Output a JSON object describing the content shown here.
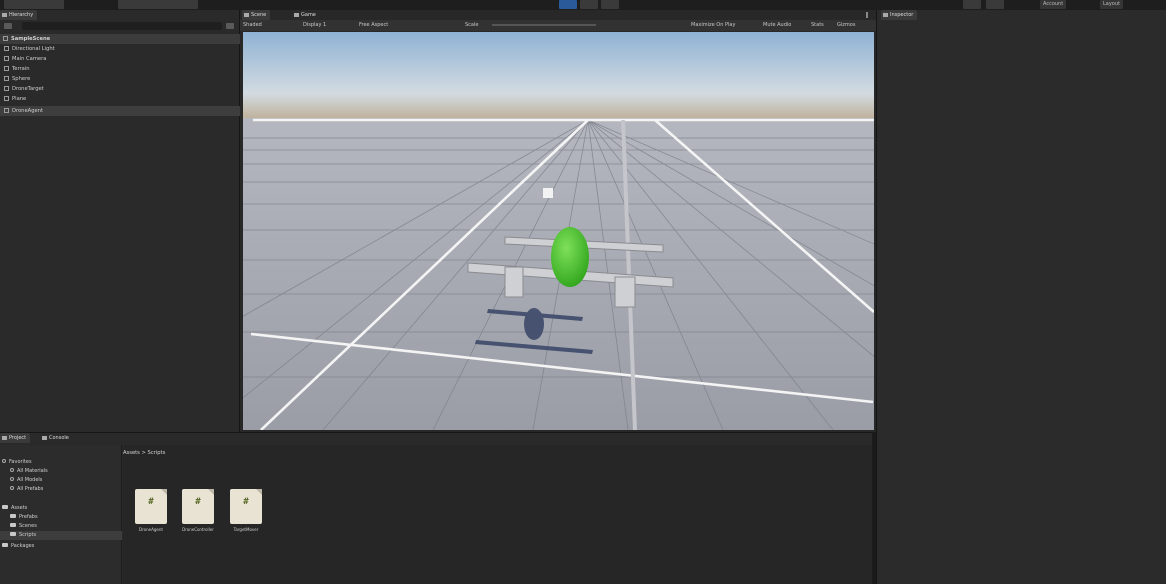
{
  "toolbar": {
    "right_labels": [
      "Account",
      "Layout"
    ]
  },
  "hierarchy": {
    "tab_label": "Hierarchy",
    "scene_name": "SampleScene",
    "items": [
      "Directional Light",
      "Main Camera",
      "Terrain",
      "Sphere",
      "DroneTarget",
      "Plane",
      "DroneAgent"
    ]
  },
  "scene_view": {
    "tabs": [
      "Scene",
      "Game"
    ],
    "shading_mode": "Shaded",
    "display": "Display 1",
    "aspect": "Free Aspect",
    "scale_label": "Scale",
    "right_items": [
      "Maximize On Play",
      "Mute Audio",
      "Stats",
      "Gizmos"
    ]
  },
  "inspector": {
    "tab_label": "Inspector"
  },
  "project": {
    "tabs": [
      "Project",
      "Console"
    ],
    "favorites_label": "Favorites",
    "favorites": [
      "All Materials",
      "All Models",
      "All Prefabs"
    ],
    "assets_label": "Assets",
    "asset_folders": [
      "Prefabs",
      "Scenes",
      "Scripts"
    ],
    "packages_label": "Packages",
    "breadcrumb": "Assets > Scripts",
    "files": [
      {
        "name": "DroneAgent",
        "glyph": "#"
      },
      {
        "name": "DroneController",
        "glyph": "#"
      },
      {
        "name": "TargetMover",
        "glyph": "#"
      }
    ]
  },
  "colors": {
    "accent": "#2b5a9a",
    "target_green": "#3fbf2a",
    "sky_top": "#8fb2d4",
    "ground": "#8d9099"
  }
}
